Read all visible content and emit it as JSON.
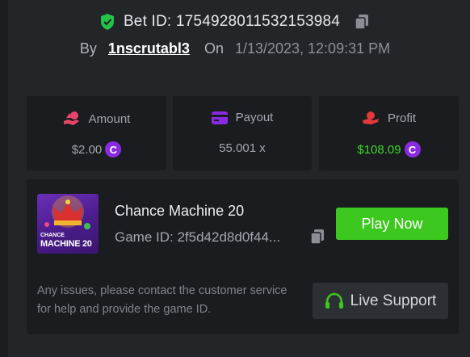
{
  "header": {
    "bet_id": "Bet ID: 1754928011532153984",
    "by_label": "By",
    "username": "1nscrutabl3",
    "on_label": "On",
    "date": "1/13/2023, 12:09:31 PM"
  },
  "stats": {
    "amount": {
      "label": "Amount",
      "value": "$2.00",
      "coin": "C"
    },
    "payout": {
      "label": "Payout",
      "value": "55.001 x"
    },
    "profit": {
      "label": "Profit",
      "value": "$108.09",
      "coin": "C"
    }
  },
  "game": {
    "thumb_line1": "CHANCE",
    "thumb_line2": "MACHINE 20",
    "name": "Chance Machine 20",
    "id": "Game ID: 2f5d42d8d0f44...",
    "play_label": "Play Now"
  },
  "support": {
    "note": "Any issues, please contact the customer service for help and provide the game ID.",
    "button_label": "Live Support"
  },
  "colors": {
    "profit_green": "#3fd62a",
    "play_green": "#3cc81f",
    "coin_purple": "#8a2be2",
    "shield_green": "#21c34a"
  }
}
